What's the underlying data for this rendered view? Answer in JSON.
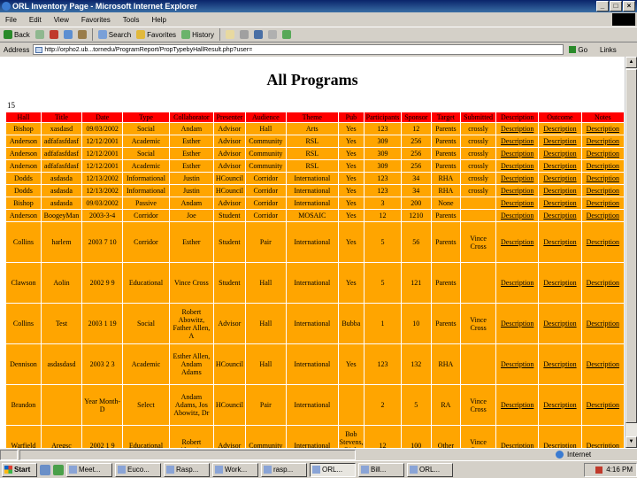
{
  "window": {
    "title": "ORL Inventory Page - Microsoft Internet Explorer"
  },
  "menu": [
    "File",
    "Edit",
    "View",
    "Favorites",
    "Tools",
    "Help"
  ],
  "toolbar": {
    "back": "Back",
    "search": "Search",
    "favorites": "Favorites",
    "history": "History"
  },
  "address": {
    "label": "Address",
    "url": "http://orpho2.ub...tornedu/ProgramReport/PropTypebyHallResult.php?user=",
    "go": "Go",
    "links": "Links"
  },
  "page": {
    "title": "All Programs",
    "record_count": "15"
  },
  "table": {
    "headers": [
      "Hall",
      "Title",
      "Date",
      "Type",
      "Collaborator",
      "Presenter",
      "Audience",
      "Theme",
      "Pub",
      "Participants",
      "Sponsor",
      "Target",
      "Submitted",
      "Description",
      "Outcome",
      "Notes"
    ],
    "rows": [
      [
        "Bishop",
        "xasdasd",
        "09/03/2002",
        "Social",
        "Andam",
        "Advisor",
        "Hall",
        "Arts",
        "Yes",
        "123",
        "12",
        "Parents",
        "crossly",
        "Description",
        "Description",
        "Description"
      ],
      [
        "Anderson",
        "adfafasfdasf",
        "12/12/2001",
        "Academic",
        "Esther",
        "Advisor",
        "Community",
        "RSL",
        "Yes",
        "309",
        "256",
        "Parents",
        "crossly",
        "Description",
        "Description",
        "Description"
      ],
      [
        "Anderson",
        "adfafasfdasf",
        "12/12/2001",
        "Social",
        "Esther",
        "Advisor",
        "Community",
        "RSL",
        "Yes",
        "309",
        "256",
        "Parents",
        "crossly",
        "Description",
        "Description",
        "Description"
      ],
      [
        "Anderson",
        "adfafasfdasf",
        "12/12/2001",
        "Academic",
        "Esther",
        "Advisor",
        "Community",
        "RSL",
        "Yes",
        "309",
        "256",
        "Parents",
        "crossly",
        "Description",
        "Description",
        "Description"
      ],
      [
        "Dodds",
        "asdasda",
        "12/13/2002",
        "Informational",
        "Justin",
        "HCouncil",
        "Corridor",
        "International",
        "Yes",
        "123",
        "34",
        "RHA",
        "crossly",
        "Description",
        "Description",
        "Description"
      ],
      [
        "Dodds",
        "asdasda",
        "12/13/2002",
        "Informational",
        "Justin",
        "HCouncil",
        "Corridor",
        "International",
        "Yes",
        "123",
        "34",
        "RHA",
        "crossly",
        "Description",
        "Description",
        "Description"
      ],
      [
        "Bishop",
        "asdasda",
        "09/03/2002",
        "Passive",
        "Andam",
        "Advisor",
        "Corridor",
        "International",
        "Yes",
        "3",
        "200",
        "None",
        "",
        "Description",
        "Description",
        "Description"
      ],
      [
        "Anderson",
        "BoogeyMan",
        "2003-3-4",
        "Corridor",
        "Joe",
        "Student",
        "Corridor",
        "MOSAIC",
        "Yes",
        "12",
        "1210",
        "Parents",
        "",
        "Description",
        "Description",
        "Description"
      ],
      [
        "Collins",
        "harlem",
        "2003 7 10",
        "Corridor",
        "Esther",
        "Student",
        "Pair",
        "International",
        "Yes",
        "5",
        "56",
        "Parents",
        "Vince Cross",
        "Description",
        "Description",
        "Description"
      ],
      [
        "Clawson",
        "Aolin",
        "2002 9 9",
        "Educational",
        "Vince Cross",
        "Student",
        "Hall",
        "International",
        "Yes",
        "5",
        "121",
        "Parents",
        "",
        "Description",
        "Description",
        "Description"
      ],
      [
        "Collins",
        "Test",
        "2003 1 19",
        "Social",
        "Robert Abowitz, Father Allen, A",
        "Advisor",
        "Hall",
        "International",
        "Bubba",
        "1",
        "10",
        "Parents",
        "Vince Cross",
        "Description",
        "Description",
        "Description"
      ],
      [
        "Dennison",
        "asdasdasd",
        "2003 2 3",
        "Academic",
        "Esther Allen, Andam Adams",
        "HCouncil",
        "Hall",
        "International",
        "Yes",
        "123",
        "132",
        "RHA",
        "",
        "Description",
        "Description",
        "Description"
      ],
      [
        "Brandon",
        "",
        "Year Month-D",
        "Select",
        "Andam Adams, Jos Abowitz, Dr",
        "HCouncil",
        "Pair",
        "International",
        "",
        "2",
        "5",
        "RA",
        "Vince Cross",
        "Description",
        "Description",
        "Description"
      ],
      [
        "Warfield",
        "Aregsc",
        "2002 1 9",
        "Educational",
        "Robert Abowitz",
        "Advisor",
        "Community",
        "International",
        "Bob Stevens, Rich Hinkle",
        "12",
        "100",
        "Other",
        "Vince Cross",
        "Description",
        "Description",
        "Description"
      ]
    ]
  },
  "statusbar": {
    "zone": "Internet"
  },
  "taskbar": {
    "start": "Start",
    "tasks": [
      "Meet...",
      "Euco...",
      "Rasp...",
      "Work...",
      "rasp...",
      "ORL...",
      "Bill...",
      "ORL..."
    ],
    "clock": "4:16 PM"
  },
  "colors": {
    "header_bg": "#ff0000",
    "cell_bg": "#ffa500",
    "window_chrome": "#d4d0c8",
    "titlebar": "#0a246a"
  }
}
